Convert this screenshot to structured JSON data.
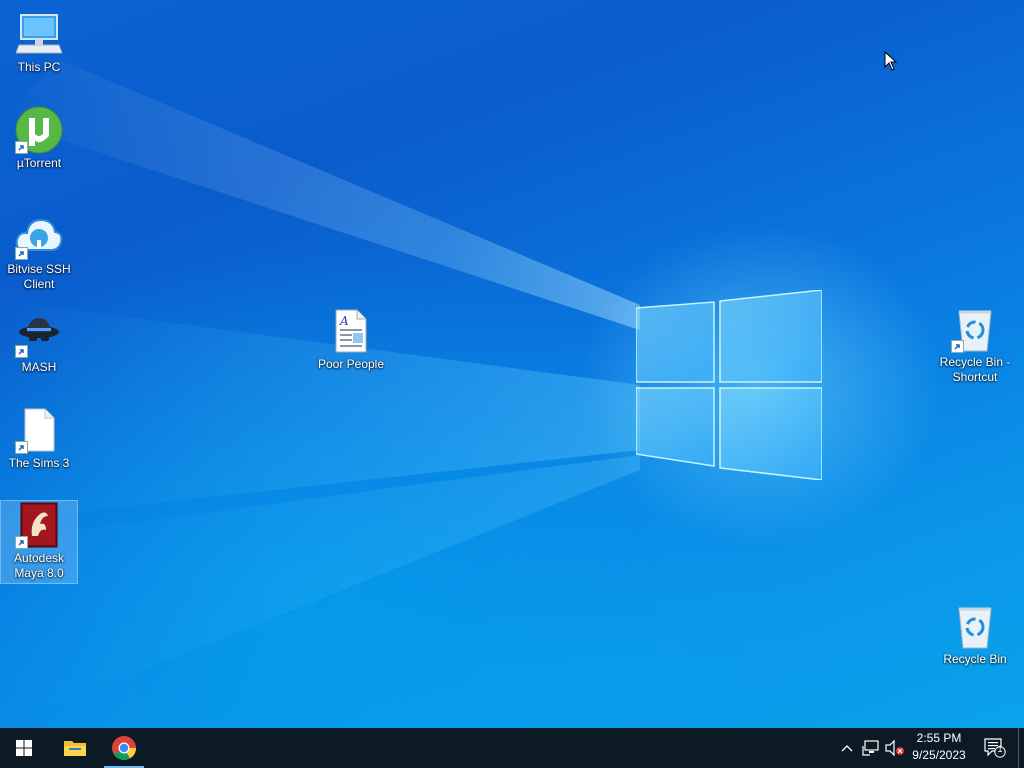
{
  "desktop": {
    "icons": [
      {
        "label": "This PC",
        "icon": "computer-icon"
      },
      {
        "label": "µTorrent",
        "icon": "utorrent-icon"
      },
      {
        "label": "Bitvise SSH Client",
        "icon": "bitvise-icon"
      },
      {
        "label": "MASH",
        "icon": "mash-icon"
      },
      {
        "label": "The Sims 3",
        "icon": "blank-file-icon"
      },
      {
        "label": "Autodesk Maya 8.0",
        "icon": "maya-icon"
      },
      {
        "label": "Poor People",
        "icon": "document-icon"
      },
      {
        "label": "Recycle Bin - Shortcut",
        "icon": "recycle-bin-icon"
      },
      {
        "label": "Recycle Bin",
        "icon": "recycle-bin-icon"
      }
    ]
  },
  "taskbar": {
    "start_icon": "windows-start-icon",
    "pinned": [
      {
        "name": "File Explorer",
        "icon": "folder-icon"
      },
      {
        "name": "Google Chrome",
        "icon": "chrome-icon"
      }
    ],
    "tray": {
      "chevron_icon": "chevron-up-icon",
      "network_icon": "network-icon",
      "volume_icon": "volume-muted-icon",
      "time": "2:55 PM",
      "date": "9/25/2023",
      "notification_count": "1"
    }
  },
  "colors": {
    "taskbar_bg": "#0c1a26",
    "desktop_blue": "#0a79e0",
    "active_indicator": "#76b9ed"
  }
}
